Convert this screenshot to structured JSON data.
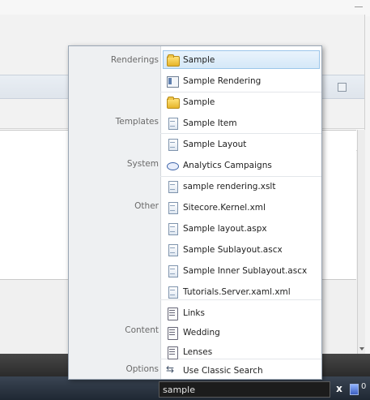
{
  "search": {
    "value": "sample",
    "clear_glyph": "x",
    "tray_text": "0"
  },
  "popup": {
    "categories": {
      "renderings": "Renderings",
      "templates": "Templates",
      "system": "System",
      "other": "Other",
      "content": "Content",
      "options": "Options"
    },
    "items": [
      {
        "label": "Sample",
        "icon": "folder-icon",
        "category": "Renderings",
        "selected": true
      },
      {
        "label": "Sample Rendering",
        "icon": "rendering-icon",
        "category": "Renderings"
      },
      {
        "label": "Sample",
        "icon": "folder-icon",
        "category": "Templates"
      },
      {
        "label": "Sample Item",
        "icon": "document-icon",
        "category": "Templates"
      },
      {
        "label": "Sample Layout",
        "icon": "document-icon",
        "category": "System"
      },
      {
        "label": "Analytics Campaigns",
        "icon": "ellipse-icon",
        "category": "System"
      },
      {
        "label": "sample rendering.xslt",
        "icon": "document-icon",
        "category": "Other"
      },
      {
        "label": "Sitecore.Kernel.xml",
        "icon": "document-icon",
        "category": "Other"
      },
      {
        "label": "Sample layout.aspx",
        "icon": "document-icon",
        "category": "Other"
      },
      {
        "label": "Sample Sublayout.ascx",
        "icon": "document-icon",
        "category": "Other"
      },
      {
        "label": "Sample Inner Sublayout.ascx",
        "icon": "document-icon",
        "category": "Other"
      },
      {
        "label": "Tutorials.Server.xaml.xml",
        "icon": "document-icon",
        "category": "Other"
      },
      {
        "label": "Links",
        "icon": "page-icon",
        "category": "Content"
      },
      {
        "label": "Wedding",
        "icon": "page-icon",
        "category": "Content"
      },
      {
        "label": "Lenses",
        "icon": "page-icon",
        "category": "Content"
      },
      {
        "label": "Use Classic Search",
        "icon": "classic-search-icon",
        "category": "Options"
      }
    ]
  },
  "colors": {
    "selection_bg": "#d5e8f8",
    "selection_border": "#9cc6ea",
    "gutter": "#eef0f2",
    "taskbar": "#1f2833"
  }
}
